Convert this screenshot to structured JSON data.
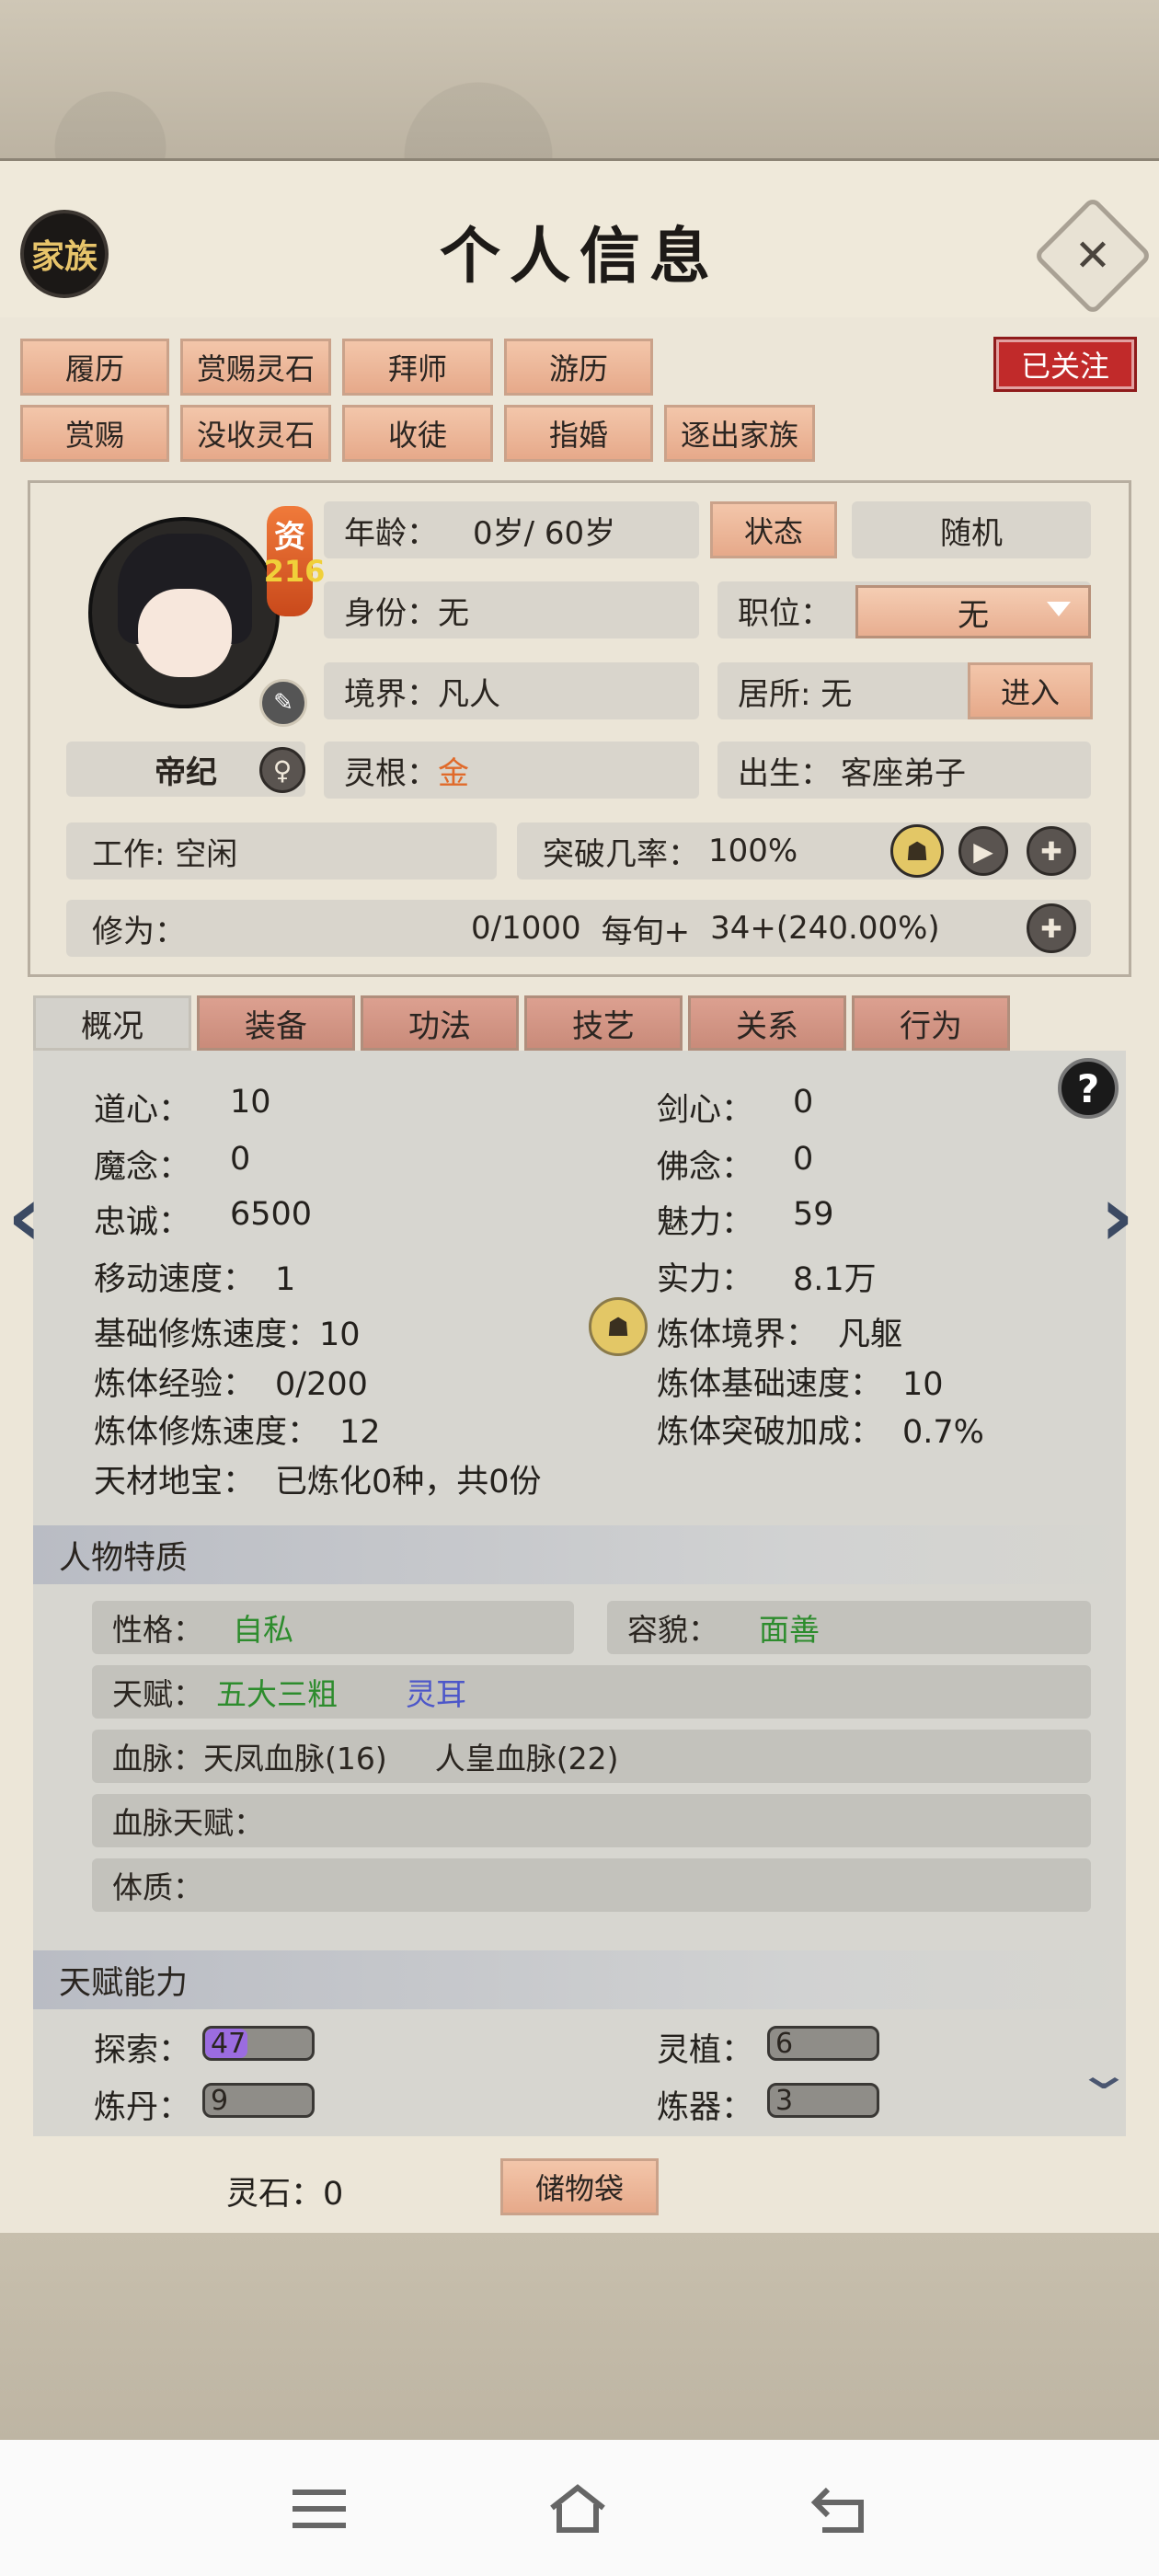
{
  "header": {
    "title": "个人信息",
    "family_label": "家族",
    "close_icon": "close-icon",
    "follow_label": "已关注"
  },
  "actions_row1": [
    "履历",
    "赏赐灵石",
    "拜师",
    "游历"
  ],
  "actions_row2": [
    "赏赐",
    "没收灵石",
    "收徒",
    "指婚",
    "逐出家族"
  ],
  "profile": {
    "resource_char": "资",
    "resource_value": "216",
    "name": "帝纪",
    "gender_icon": "female-icon",
    "age_label": "年龄：",
    "age_value": "0岁/ 60岁",
    "status_btn": "状态",
    "random_btn": "随机",
    "identity_label": "身份：",
    "identity_value": "无",
    "position_label": "职位：",
    "position_value": "无",
    "realm_label": "境界：",
    "realm_value": "凡人",
    "residence": "居所: 无",
    "enter_btn": "进入",
    "root_label": "灵根：",
    "root_value": "金",
    "birth_label": "出生：",
    "birth_value": "客座弟子",
    "work": "工作: 空闲",
    "breakthrough_label": "突破几率：",
    "breakthrough_value": "100%",
    "cultivation_label": "修为：",
    "cultivation_value": "0/1000",
    "per_term": "每旬+",
    "per_term_value": "34+(240.00%)"
  },
  "tabs": [
    "概况",
    "装备",
    "功法",
    "技艺",
    "关系",
    "行为"
  ],
  "active_tab": 0,
  "stats_left": [
    {
      "label": "道心：",
      "value": "10"
    },
    {
      "label": "魔念：",
      "value": "0"
    },
    {
      "label": "忠诚：",
      "value": "6500"
    },
    {
      "label": "移动速度：",
      "value": "1"
    },
    {
      "label": "基础修炼速度：",
      "value": "10"
    },
    {
      "label": "炼体经验：",
      "value": "0/200"
    },
    {
      "label": "炼体修炼速度：",
      "value": "12"
    },
    {
      "label": "天材地宝：",
      "value": "已炼化0种，共0份"
    }
  ],
  "stats_right": [
    {
      "label": "剑心：",
      "value": "0"
    },
    {
      "label": "佛念：",
      "value": "0"
    },
    {
      "label": "魅力：",
      "value": "59"
    },
    {
      "label": "实力：",
      "value": "8.1万"
    },
    {
      "label": "炼体境界：",
      "value": "凡躯"
    },
    {
      "label": "炼体基础速度：",
      "value": "10"
    },
    {
      "label": "炼体突破加成：",
      "value": "0.7%"
    }
  ],
  "traits": {
    "heading": "人物特质",
    "personality_label": "性格：",
    "personality_value": "自私",
    "appearance_label": "容貌：",
    "appearance_value": "面善",
    "talent_label": "天赋：",
    "talent_1": "五大三粗",
    "talent_2": "灵耳",
    "bloodline_label": "血脉：",
    "bloodline_1": "天凤血脉(16)",
    "bloodline_2": "人皇血脉(22)",
    "bloodline_talent_label": "血脉天赋：",
    "physique_label": "体质："
  },
  "abilities": {
    "heading": "天赋能力",
    "items": [
      {
        "label": "探索：",
        "value": "47",
        "fill": 0.4
      },
      {
        "label": "灵植：",
        "value": "6",
        "fill": 0
      },
      {
        "label": "炼丹：",
        "value": "9",
        "fill": 0
      },
      {
        "label": "炼器：",
        "value": "3",
        "fill": 0
      }
    ]
  },
  "footer": {
    "spirit_stone": "灵石：0",
    "bag_label": "储物袋"
  },
  "colors": {
    "accent_button": "#e6a98a",
    "follow_red": "#c12a2a",
    "green_text": "#2d8c2d",
    "blue_text": "#4d57c9",
    "gold_root": "#e06a2a"
  }
}
